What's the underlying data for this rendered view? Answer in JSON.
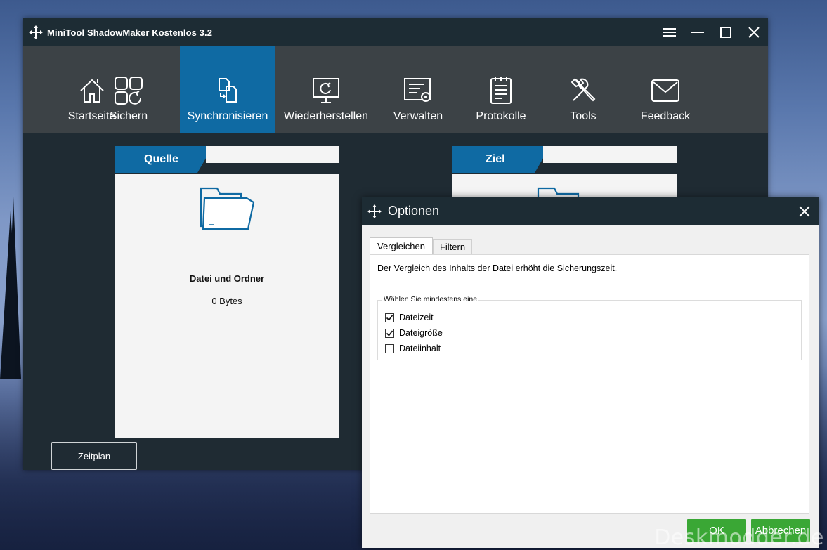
{
  "app": {
    "title": "MiniTool ShadowMaker Kostenlos 3.2"
  },
  "nav": [
    {
      "label": "Startseite",
      "icon": "home-icon"
    },
    {
      "label": "Sichern",
      "icon": "backup-icon"
    },
    {
      "label": "Synchronisieren",
      "icon": "sync-icon",
      "active": true
    },
    {
      "label": "Wiederherstellen",
      "icon": "restore-icon"
    },
    {
      "label": "Verwalten",
      "icon": "manage-icon"
    },
    {
      "label": "Protokolle",
      "icon": "log-icon"
    },
    {
      "label": "Tools",
      "icon": "tools-icon"
    },
    {
      "label": "Feedback",
      "icon": "mail-icon"
    }
  ],
  "source": {
    "tab_label": "Quelle",
    "item_title": "Datei und Ordner",
    "item_size": "0 Bytes"
  },
  "target": {
    "tab_label": "Ziel"
  },
  "schedule_button": "Zeitplan",
  "dialog": {
    "title": "Optionen",
    "tabs": [
      "Vergleichen",
      "Filtern"
    ],
    "info": "Der Vergleich des Inhalts der Datei erhöht die Sicherungszeit.",
    "group_label": "Wählen Sie mindestens eine",
    "options": [
      {
        "label": "Dateizeit",
        "checked": true
      },
      {
        "label": "Dateigröße",
        "checked": true
      },
      {
        "label": "Dateiinhalt",
        "checked": false
      }
    ],
    "ok": "OK",
    "cancel": "Abbrechen"
  },
  "watermark": "Deskmodder.de",
  "colors": {
    "accent": "#0f6aa3",
    "toolbar": "#3c4246",
    "titlebar": "#1d2c34",
    "button_green": "#3aa735"
  }
}
